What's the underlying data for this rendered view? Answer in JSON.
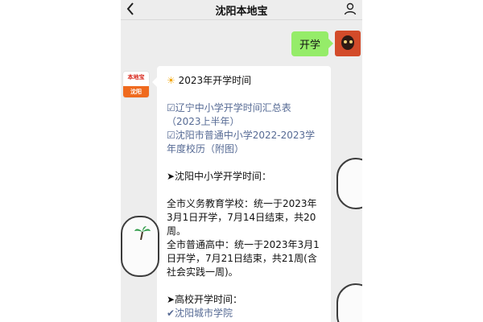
{
  "header": {
    "back_icon": "chevron-left-icon",
    "title": "沈阳本地宝",
    "profile_icon": "user-icon"
  },
  "messages": {
    "user_message": "开学",
    "bot_avatar": {
      "top_text": "本地宝",
      "bottom_text": "沈阳"
    },
    "bot_message": {
      "heading": "2023年开学时间",
      "link1": "☑辽宁中小学开学时间汇总表（2023上半年）",
      "link2": "☑沈阳市普通中小学2022-2023学年度校历（附图）",
      "section1_title": "➤沈阳中小学开学时间：",
      "p1": "全市义务教育学校：统一于2023年3月1日开学，7月14日结束，共20周。",
      "p2": "全市普通高中：统一于2023年3月1日开学，7月21日结束，共21周(含社会实践一周)。",
      "section2_title": "➤高校开学时间：",
      "link3": "✔沈阳城市学院"
    }
  },
  "colors": {
    "bubble_right": "#95ec69",
    "link": "#576b95",
    "background": "#ededed"
  }
}
